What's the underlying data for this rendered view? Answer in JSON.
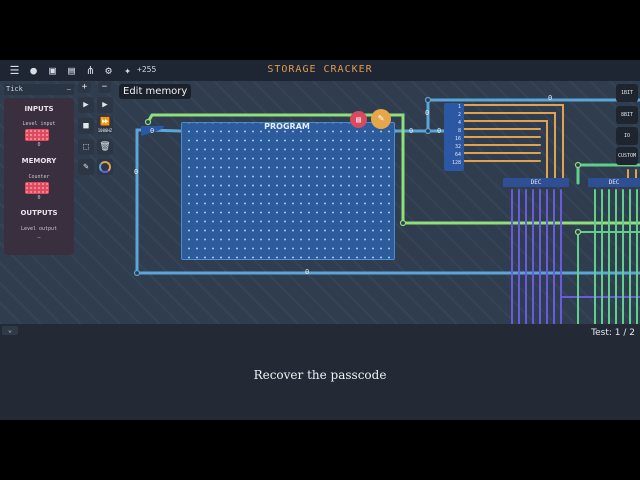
{
  "topbar": {
    "icons": [
      "menu-icon",
      "chat-icon",
      "save-icon",
      "layers-icon",
      "hierarchy-icon",
      "gear-icon",
      "wrench-icon"
    ],
    "score": "+255",
    "title": "STORAGE CRACKER"
  },
  "tick_select": {
    "value": "Tick"
  },
  "sidepanel": {
    "inputs_heading": "INPUTS",
    "inputs_sub": "Level input",
    "inputs_value": "0",
    "memory_heading": "MEMORY",
    "memory_sub": "Counter",
    "memory_value": "0",
    "outputs_heading": "OUTPUTS",
    "outputs_sub": "Level output",
    "outputs_value": "–"
  },
  "tools": {
    "zoom_in": "+",
    "zoom_out": "−",
    "play": "▶",
    "stop": "■",
    "fast_forward": "⏩",
    "fast_forward_label": "1000HZ",
    "select": "⬚",
    "delete": "🗑",
    "pencil": "✎"
  },
  "tooltip": "Edit memory",
  "program": {
    "title": "PROGRAM",
    "memory_button": "▤",
    "edit_button": "✎"
  },
  "wire_labels": {
    "top_right": "0",
    "left_loop": "0",
    "bottom": "0",
    "prog_in": "0",
    "prog_out": "0",
    "mid": "0",
    "bits_in": "0"
  },
  "bit_labels": [
    "1",
    "2",
    "4",
    "8",
    "16",
    "32",
    "64",
    "128"
  ],
  "decoders": [
    "DEC",
    "DEC"
  ],
  "right_buttons": [
    "1BIT",
    "8BIT",
    "IO",
    "CUSTOM"
  ],
  "bottom": {
    "collapse": "⌄",
    "test_counter": "Test: 1 / 2",
    "objective": "Recover the passcode"
  },
  "colors": {
    "accent_orange": "#e09a4e",
    "wire_blue": "#5ba6d8",
    "wire_green": "#8fe07a",
    "wire_orange": "#e0a24e",
    "wire_purple": "#6a5ae0",
    "chip_pink": "#e0485e"
  }
}
